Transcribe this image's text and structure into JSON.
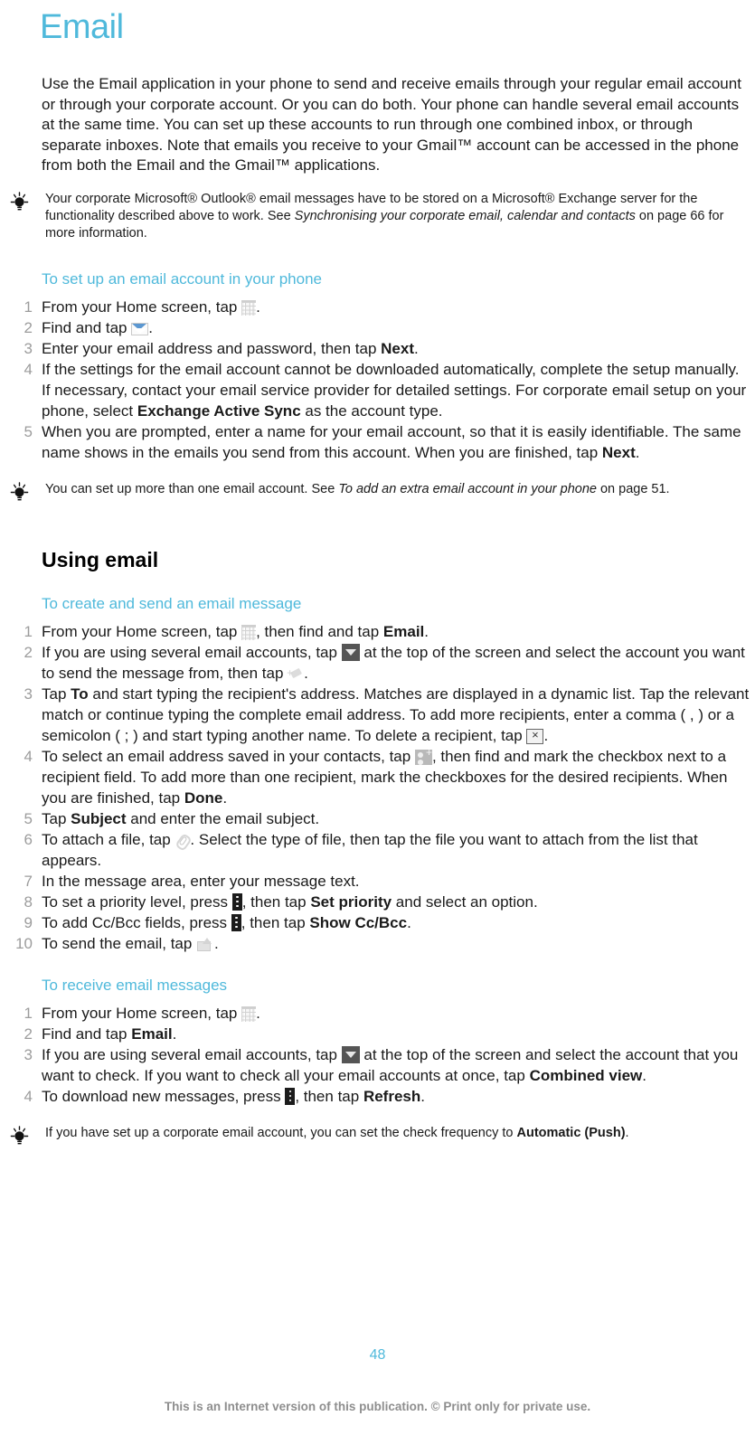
{
  "page": {
    "title": "Email",
    "number": "48",
    "copyright": "This is an Internet version of this publication. © Print only for private use."
  },
  "intro": {
    "text": "Use the Email application in your phone to send and receive emails through your regular email account or through your corporate account. Or you can do both. Your phone can handle several email accounts at the same time. You can set up these accounts to run through one combined inbox, or through separate inboxes. Note that emails you receive to your Gmail™ account can be accessed in the phone from both the Email and the Gmail™ applications."
  },
  "tip1": {
    "part1": "Your corporate Microsoft® Outlook® email messages have to be stored on a Microsoft® Exchange server for the functionality described above to work. See ",
    "italic": "Synchronising your corporate email, calendar and contacts",
    "part2": " on page 66 for more information."
  },
  "section_setup": {
    "heading": "To set up an email account in your phone",
    "steps": [
      {
        "num": "1",
        "pre": "From your Home screen, tap ",
        "icon": "grid-icon",
        "post": "."
      },
      {
        "num": "2",
        "pre": "Find and tap ",
        "icon": "envelope-icon",
        "post": "."
      },
      {
        "num": "3",
        "pre": "Enter your email address and password, then tap ",
        "bold": "Next",
        "post": "."
      },
      {
        "num": "4",
        "pre": "If the settings for the email account cannot be downloaded automatically, complete the setup manually. If necessary, contact your email service provider for detailed settings. For corporate email setup on your phone, select ",
        "bold": "Exchange Active Sync",
        "post": " as the account type."
      },
      {
        "num": "5",
        "pre": "When you are prompted, enter a name for your email account, so that it is easily identifiable. The same name shows in the emails you send from this account. When you are finished, tap ",
        "bold": "Next",
        "post": "."
      }
    ]
  },
  "tip2": {
    "part1": "You can set up more than one email account. See ",
    "italic": "To add an extra email account in your phone",
    "part2": " on page 51."
  },
  "section_using": {
    "heading": "Using email"
  },
  "section_create": {
    "heading": "To create and send an email message",
    "steps": [
      {
        "num": "1",
        "pre": "From your Home screen, tap ",
        "icon": "grid-icon",
        "mid": ", then find and tap ",
        "bold": "Email",
        "post": "."
      },
      {
        "num": "2",
        "pre": "If you are using several email accounts, tap ",
        "icon": "dropdown-icon",
        "mid": " at the top of the screen and select the account you want to send the message from, then tap ",
        "icon2": "compose-icon",
        "post": "."
      },
      {
        "num": "3",
        "pre": "Tap ",
        "bold": "To",
        "mid": " and start typing the recipient's address. Matches are displayed in a dynamic list. Tap the relevant match or continue typing the complete email address. To add more recipients, enter a comma ( , ) or a semicolon ( ; ) and start typing another name. To delete a recipient, tap ",
        "icon2": "backspace-icon",
        "post": "."
      },
      {
        "num": "4",
        "pre": "To select an email address saved in your contacts, tap ",
        "icon": "add-contact-icon",
        "mid": ", then find and mark the checkbox next to a recipient field. To add more than one recipient, mark the checkboxes for the desired recipients. When you are finished, tap ",
        "bold": "Done",
        "post": "."
      },
      {
        "num": "5",
        "pre": "Tap ",
        "bold": "Subject",
        "post": " and enter the email subject."
      },
      {
        "num": "6",
        "pre": "To attach a file, tap ",
        "icon": "paperclip-icon",
        "post": ". Select the type of file, then tap the file you want to attach from the list that appears."
      },
      {
        "num": "7",
        "pre": "In the message area, enter your message text."
      },
      {
        "num": "8",
        "pre": "To set a priority level, press ",
        "icon": "menu-key-icon",
        "mid": ", then tap ",
        "bold": "Set priority",
        "post": " and select an option."
      },
      {
        "num": "9",
        "pre": "To add Cc/Bcc fields, press ",
        "icon": "menu-key-icon",
        "mid": ", then tap ",
        "bold": "Show Cc/Bcc",
        "post": "."
      },
      {
        "num": "10",
        "pre": "To send the email, tap ",
        "icon": "send-icon",
        "post": "."
      }
    ]
  },
  "section_receive": {
    "heading": "To receive email messages",
    "steps": [
      {
        "num": "1",
        "pre": "From your Home screen, tap ",
        "icon": "grid-icon",
        "post": "."
      },
      {
        "num": "2",
        "pre": "Find and tap ",
        "bold": "Email",
        "post": "."
      },
      {
        "num": "3",
        "pre": "If you are using several email accounts, tap ",
        "icon": "dropdown-icon",
        "mid": " at the top of the screen and select the account that you want to check. If you want to check all your email accounts at once, tap ",
        "bold": "Combined view",
        "post": "."
      },
      {
        "num": "4",
        "pre": "To download new messages, press ",
        "icon": "menu-key-icon",
        "mid": ", then tap ",
        "bold": "Refresh",
        "post": "."
      }
    ]
  },
  "tip3": {
    "part1": "If you have set up a corporate email account, you can set the check frequency to ",
    "bold": "Automatic (Push)",
    "part2": "."
  },
  "colors": {
    "accent": "#4fb9db",
    "text": "#1a1a1a",
    "step_number": "#9c9c9c",
    "footer": "#8e8e8e"
  }
}
